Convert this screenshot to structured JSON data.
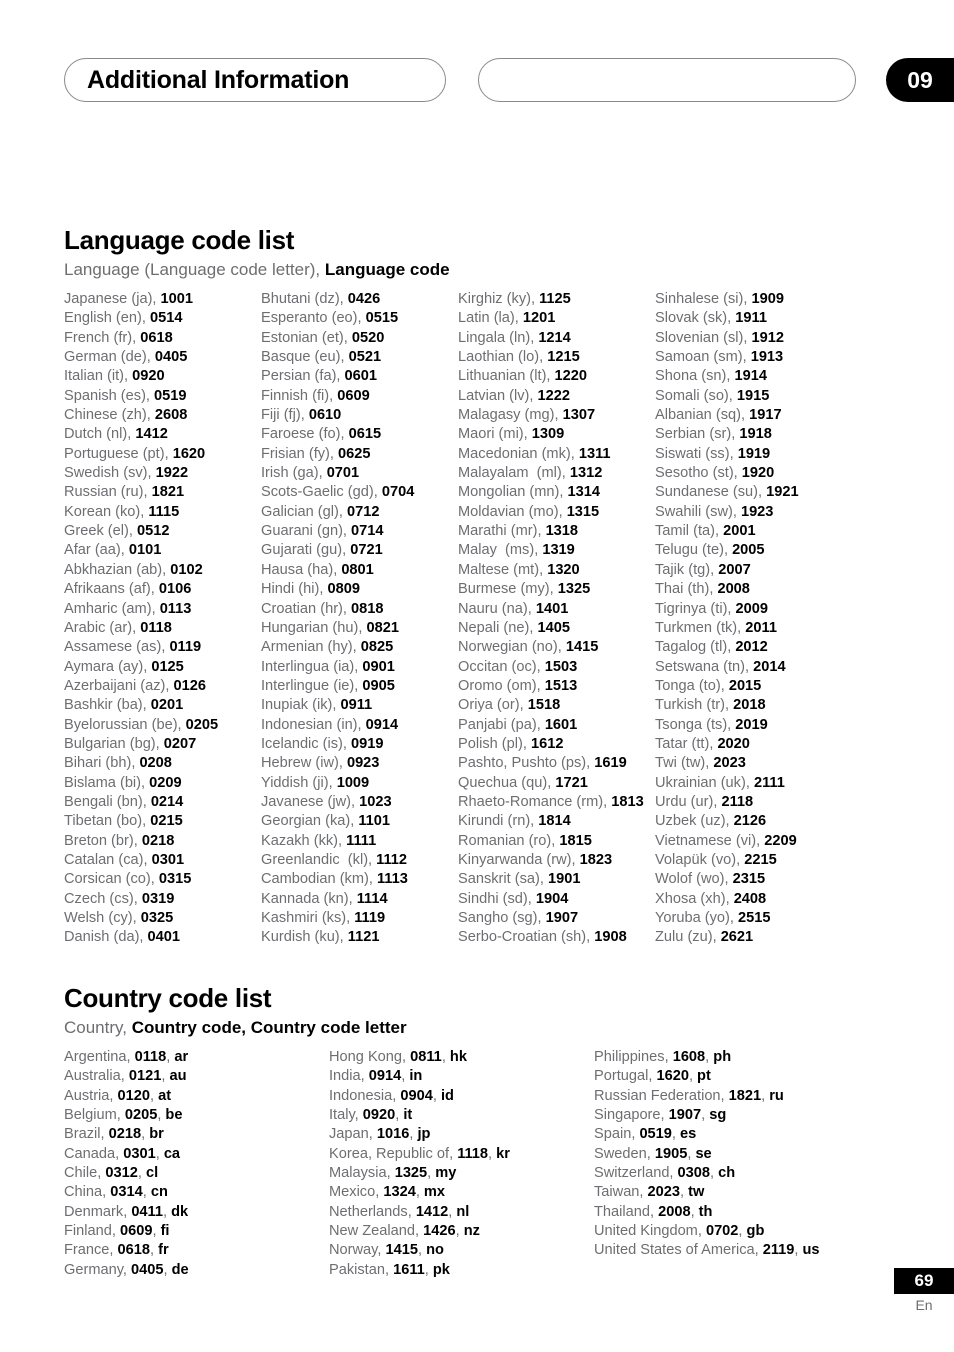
{
  "header": {
    "title": "Additional Information",
    "chapter_badge": "09"
  },
  "language_section": {
    "title": "Language code list",
    "subtitle_plain": "Language (Language code letter), ",
    "subtitle_bold": "Language code",
    "columns": [
      [
        {
          "name": "Japanese (ja), ",
          "code": "1001"
        },
        {
          "name": "English (en), ",
          "code": "0514"
        },
        {
          "name": "French (fr), ",
          "code": "0618"
        },
        {
          "name": "German (de), ",
          "code": "0405"
        },
        {
          "name": "Italian (it), ",
          "code": "0920"
        },
        {
          "name": "Spanish (es), ",
          "code": "0519"
        },
        {
          "name": "Chinese (zh), ",
          "code": "2608"
        },
        {
          "name": "Dutch (nl), ",
          "code": "1412"
        },
        {
          "name": "Portuguese (pt), ",
          "code": "1620"
        },
        {
          "name": "Swedish (sv), ",
          "code": "1922"
        },
        {
          "name": "Russian (ru), ",
          "code": "1821"
        },
        {
          "name": "Korean (ko), ",
          "code": "1115"
        },
        {
          "name": "Greek (el), ",
          "code": "0512"
        },
        {
          "name": "Afar (aa), ",
          "code": "0101"
        },
        {
          "name": "Abkhazian (ab), ",
          "code": "0102"
        },
        {
          "name": "Afrikaans (af), ",
          "code": "0106"
        },
        {
          "name": "Amharic (am), ",
          "code": "0113"
        },
        {
          "name": "Arabic (ar), ",
          "code": "0118"
        },
        {
          "name": "Assamese (as), ",
          "code": "0119"
        },
        {
          "name": "Aymara (ay), ",
          "code": "0125"
        },
        {
          "name": "Azerbaijani (az), ",
          "code": "0126"
        },
        {
          "name": "Bashkir (ba), ",
          "code": "0201"
        },
        {
          "name": "Byelorussian (be), ",
          "code": "0205"
        },
        {
          "name": "Bulgarian (bg), ",
          "code": "0207"
        },
        {
          "name": "Bihari (bh), ",
          "code": "0208"
        },
        {
          "name": "Bislama (bi), ",
          "code": "0209"
        },
        {
          "name": "Bengali (bn), ",
          "code": "0214"
        },
        {
          "name": "Tibetan (bo), ",
          "code": "0215"
        },
        {
          "name": "Breton (br), ",
          "code": "0218"
        },
        {
          "name": "Catalan (ca), ",
          "code": "0301"
        },
        {
          "name": "Corsican (co), ",
          "code": "0315"
        },
        {
          "name": "Czech (cs), ",
          "code": "0319"
        },
        {
          "name": "Welsh (cy), ",
          "code": "0325"
        },
        {
          "name": "Danish (da), ",
          "code": "0401"
        }
      ],
      [
        {
          "name": "Bhutani (dz), ",
          "code": "0426"
        },
        {
          "name": "Esperanto (eo), ",
          "code": "0515"
        },
        {
          "name": "Estonian (et), ",
          "code": "0520"
        },
        {
          "name": "Basque (eu), ",
          "code": "0521"
        },
        {
          "name": "Persian (fa), ",
          "code": "0601"
        },
        {
          "name": "Finnish (fi), ",
          "code": "0609"
        },
        {
          "name": "Fiji (fj), ",
          "code": "0610"
        },
        {
          "name": "Faroese (fo), ",
          "code": "0615"
        },
        {
          "name": "Frisian (fy), ",
          "code": "0625"
        },
        {
          "name": "Irish (ga), ",
          "code": "0701"
        },
        {
          "name": "Scots-Gaelic (gd), ",
          "code": "0704"
        },
        {
          "name": "Galician (gl), ",
          "code": "0712"
        },
        {
          "name": "Guarani (gn), ",
          "code": "0714"
        },
        {
          "name": "Gujarati (gu), ",
          "code": "0721"
        },
        {
          "name": "Hausa (ha), ",
          "code": "0801"
        },
        {
          "name": "Hindi (hi), ",
          "code": "0809"
        },
        {
          "name": "Croatian (hr), ",
          "code": "0818"
        },
        {
          "name": "Hungarian (hu), ",
          "code": "0821"
        },
        {
          "name": "Armenian (hy), ",
          "code": "0825"
        },
        {
          "name": "Interlingua (ia), ",
          "code": "0901"
        },
        {
          "name": "Interlingue (ie), ",
          "code": "0905"
        },
        {
          "name": "Inupiak (ik), ",
          "code": "0911"
        },
        {
          "name": "Indonesian (in), ",
          "code": "0914"
        },
        {
          "name": "Icelandic (is), ",
          "code": "0919"
        },
        {
          "name": "Hebrew (iw), ",
          "code": "0923"
        },
        {
          "name": "Yiddish (ji), ",
          "code": "1009"
        },
        {
          "name": "Javanese (jw), ",
          "code": "1023"
        },
        {
          "name": "Georgian (ka), ",
          "code": "1101"
        },
        {
          "name": "Kazakh (kk), ",
          "code": "1111"
        },
        {
          "name": "Greenlandic  (kl), ",
          "code": "1112"
        },
        {
          "name": "Cambodian (km), ",
          "code": "1113"
        },
        {
          "name": "Kannada (kn), ",
          "code": "1114"
        },
        {
          "name": "Kashmiri (ks), ",
          "code": "1119"
        },
        {
          "name": "Kurdish (ku), ",
          "code": "1121"
        }
      ],
      [
        {
          "name": "Kirghiz (ky), ",
          "code": "1125"
        },
        {
          "name": "Latin (la), ",
          "code": "1201"
        },
        {
          "name": "Lingala (ln), ",
          "code": "1214"
        },
        {
          "name": "Laothian (lo), ",
          "code": "1215"
        },
        {
          "name": "Lithuanian (lt), ",
          "code": "1220"
        },
        {
          "name": "Latvian (lv), ",
          "code": "1222"
        },
        {
          "name": "Malagasy (mg), ",
          "code": "1307"
        },
        {
          "name": "Maori (mi), ",
          "code": "1309"
        },
        {
          "name": "Macedonian (mk), ",
          "code": "1311"
        },
        {
          "name": "Malayalam  (ml), ",
          "code": "1312"
        },
        {
          "name": "Mongolian (mn), ",
          "code": "1314"
        },
        {
          "name": "Moldavian (mo), ",
          "code": "1315"
        },
        {
          "name": "Marathi (mr), ",
          "code": "1318"
        },
        {
          "name": "Malay  (ms), ",
          "code": "1319"
        },
        {
          "name": "Maltese (mt), ",
          "code": "1320"
        },
        {
          "name": "Burmese (my), ",
          "code": "1325"
        },
        {
          "name": "Nauru (na), ",
          "code": "1401"
        },
        {
          "name": "Nepali (ne), ",
          "code": "1405"
        },
        {
          "name": "Norwegian (no), ",
          "code": "1415"
        },
        {
          "name": "Occitan (oc), ",
          "code": "1503"
        },
        {
          "name": "Oromo (om), ",
          "code": "1513"
        },
        {
          "name": "Oriya (or), ",
          "code": "1518"
        },
        {
          "name": "Panjabi (pa), ",
          "code": "1601"
        },
        {
          "name": "Polish (pl), ",
          "code": "1612"
        },
        {
          "name": "Pashto, Pushto (ps), ",
          "code": "1619"
        },
        {
          "name": "Quechua (qu), ",
          "code": "1721"
        },
        {
          "name": "Rhaeto-Romance (rm), ",
          "code": "1813"
        },
        {
          "name": "Kirundi (rn), ",
          "code": "1814"
        },
        {
          "name": "Romanian (ro), ",
          "code": "1815"
        },
        {
          "name": "Kinyarwanda (rw), ",
          "code": "1823"
        },
        {
          "name": "Sanskrit (sa), ",
          "code": "1901"
        },
        {
          "name": "Sindhi (sd), ",
          "code": "1904"
        },
        {
          "name": "Sangho (sg), ",
          "code": "1907"
        },
        {
          "name": "Serbo-Croatian (sh), ",
          "code": "1908"
        }
      ],
      [
        {
          "name": "Sinhalese (si), ",
          "code": "1909"
        },
        {
          "name": "Slovak (sk), ",
          "code": "1911"
        },
        {
          "name": "Slovenian (sl), ",
          "code": "1912"
        },
        {
          "name": "Samoan (sm), ",
          "code": "1913"
        },
        {
          "name": "Shona (sn), ",
          "code": "1914"
        },
        {
          "name": "Somali (so), ",
          "code": "1915"
        },
        {
          "name": "Albanian (sq), ",
          "code": "1917"
        },
        {
          "name": "Serbian (sr), ",
          "code": "1918"
        },
        {
          "name": "Siswati (ss), ",
          "code": "1919"
        },
        {
          "name": "Sesotho (st), ",
          "code": "1920"
        },
        {
          "name": "Sundanese (su), ",
          "code": "1921"
        },
        {
          "name": "Swahili (sw), ",
          "code": "1923"
        },
        {
          "name": "Tamil (ta), ",
          "code": "2001"
        },
        {
          "name": "Telugu (te), ",
          "code": "2005"
        },
        {
          "name": "Tajik (tg), ",
          "code": "2007"
        },
        {
          "name": "Thai (th), ",
          "code": "2008"
        },
        {
          "name": "Tigrinya (ti), ",
          "code": "2009"
        },
        {
          "name": "Turkmen (tk), ",
          "code": "2011"
        },
        {
          "name": "Tagalog (tl), ",
          "code": "2012"
        },
        {
          "name": "Setswana (tn), ",
          "code": "2014"
        },
        {
          "name": "Tonga (to), ",
          "code": "2015"
        },
        {
          "name": "Turkish (tr), ",
          "code": "2018"
        },
        {
          "name": "Tsonga (ts), ",
          "code": "2019"
        },
        {
          "name": "Tatar (tt), ",
          "code": "2020"
        },
        {
          "name": "Twi (tw), ",
          "code": "2023"
        },
        {
          "name": "Ukrainian (uk), ",
          "code": "2111"
        },
        {
          "name": "Urdu (ur), ",
          "code": "2118"
        },
        {
          "name": "Uzbek (uz), ",
          "code": "2126"
        },
        {
          "name": "Vietnamese (vi), ",
          "code": "2209"
        },
        {
          "name": "Volapük (vo), ",
          "code": "2215"
        },
        {
          "name": "Wolof (wo), ",
          "code": "2315"
        },
        {
          "name": "Xhosa (xh), ",
          "code": "2408"
        },
        {
          "name": "Yoruba (yo), ",
          "code": "2515"
        },
        {
          "name": "Zulu (zu), ",
          "code": "2621"
        }
      ]
    ]
  },
  "country_section": {
    "title": "Country code list",
    "subtitle_plain": "Country, ",
    "subtitle_bold": "Country code, Country code letter",
    "columns": [
      [
        {
          "name": "Argentina, ",
          "code": "0118",
          "letter": "ar"
        },
        {
          "name": "Australia, ",
          "code": "0121",
          "letter": "au"
        },
        {
          "name": "Austria, ",
          "code": "0120",
          "letter": "at"
        },
        {
          "name": "Belgium, ",
          "code": "0205",
          "letter": "be"
        },
        {
          "name": "Brazil, ",
          "code": "0218",
          "letter": "br"
        },
        {
          "name": "Canada, ",
          "code": "0301",
          "letter": "ca"
        },
        {
          "name": "Chile, ",
          "code": "0312",
          "letter": "cl"
        },
        {
          "name": "China, ",
          "code": "0314",
          "letter": "cn"
        },
        {
          "name": "Denmark, ",
          "code": "0411",
          "letter": "dk"
        },
        {
          "name": "Finland, ",
          "code": "0609",
          "letter": "fi"
        },
        {
          "name": "France, ",
          "code": "0618",
          "letter": "fr"
        },
        {
          "name": "Germany, ",
          "code": "0405",
          "letter": "de"
        }
      ],
      [
        {
          "name": "Hong Kong, ",
          "code": "0811",
          "letter": "hk"
        },
        {
          "name": "India, ",
          "code": "0914",
          "letter": "in"
        },
        {
          "name": "Indonesia, ",
          "code": "0904",
          "letter": "id"
        },
        {
          "name": "Italy, ",
          "code": "0920",
          "letter": "it"
        },
        {
          "name": "Japan, ",
          "code": "1016",
          "letter": "jp"
        },
        {
          "name": "Korea, Republic of, ",
          "code": "1118",
          "letter": "kr"
        },
        {
          "name": "Malaysia, ",
          "code": "1325",
          "letter": "my"
        },
        {
          "name": "Mexico, ",
          "code": "1324",
          "letter": "mx"
        },
        {
          "name": "Netherlands, ",
          "code": "1412",
          "letter": "nl"
        },
        {
          "name": "New Zealand, ",
          "code": "1426",
          "letter": "nz"
        },
        {
          "name": "Norway, ",
          "code": "1415",
          "letter": "no"
        },
        {
          "name": "Pakistan, ",
          "code": "1611",
          "letter": "pk"
        }
      ],
      [
        {
          "name": "Philippines, ",
          "code": "1608",
          "letter": "ph"
        },
        {
          "name": "Portugal, ",
          "code": "1620",
          "letter": "pt"
        },
        {
          "name": "Russian Federation, ",
          "code": "1821",
          "letter": "ru"
        },
        {
          "name": "Singapore, ",
          "code": "1907",
          "letter": "sg"
        },
        {
          "name": "Spain, ",
          "code": "0519",
          "letter": "es"
        },
        {
          "name": "Sweden, ",
          "code": "1905",
          "letter": "se"
        },
        {
          "name": "Switzerland, ",
          "code": "0308",
          "letter": "ch"
        },
        {
          "name": "Taiwan, ",
          "code": "2023",
          "letter": "tw"
        },
        {
          "name": "Thailand, ",
          "code": "2008",
          "letter": "th"
        },
        {
          "name": "United Kingdom, ",
          "code": "0702",
          "letter": "gb"
        },
        {
          "name": "United States of America, ",
          "code": "2119",
          "letter": "us"
        }
      ]
    ]
  },
  "footer": {
    "page_number": "69",
    "language": "En"
  },
  "colors": {
    "text_grey": "#6d6e71",
    "text_black": "#000000",
    "badge_bg": "#000000",
    "pill_border": "#8a8a8a"
  }
}
